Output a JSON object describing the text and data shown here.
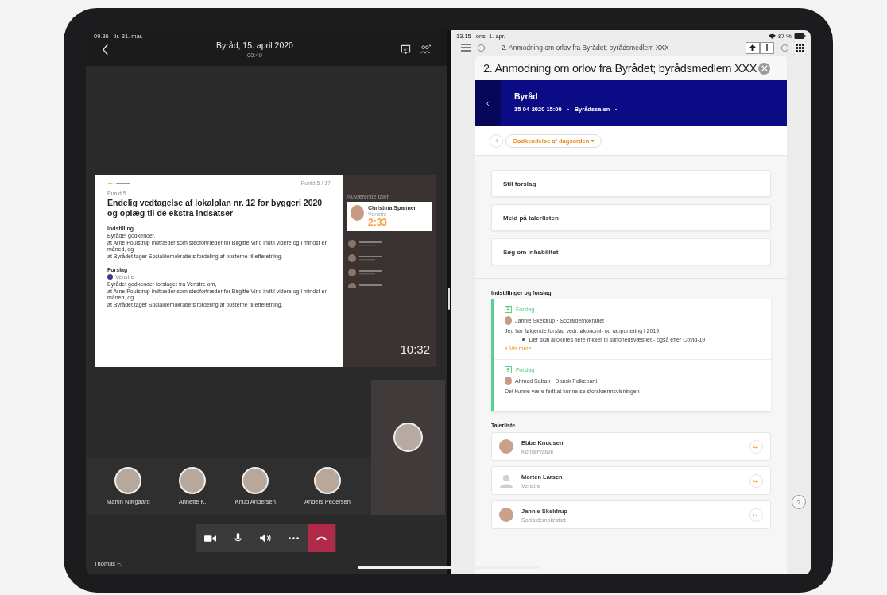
{
  "left_app": {
    "status_time": "09.36",
    "status_date": "tir. 31. mar.",
    "title": "Byråd, 15. april 2020",
    "duration": "00:40",
    "slide": {
      "page": "Punkt 5 / 17",
      "label": "Punkt 5",
      "heading": "Endelig vedtagelse af lokalplan nr. 12 for byggeri 2020 og oplæg til de ekstra indsatser",
      "sections": [
        {
          "heading": "Indstilling",
          "lines": [
            "Byrådet godkender,",
            "at Arne Poulstrup indtræder som stedfortræder for Birgitte Vind indtil videre og i mindst en måned, og",
            "at Byrådet tager Socialdemokratiets fordeling af posterne til efteretning."
          ]
        },
        {
          "heading": "Forslag",
          "party": "Venstre",
          "lines": [
            "Byrådet godkender forslaget fra Venstre om,",
            "at Arne Poulstrup indtræder som stedfortræder for Birgitte Vind indtil videre og i mindst en måned, og",
            "at Byrådet tager Socialdemokratiets fordeling af posterne til efteretning."
          ]
        }
      ]
    },
    "speaker_panel": {
      "label": "Nuværende taler",
      "name": "Christina Spanner",
      "party": "Venstre",
      "time": "2:33"
    },
    "clock": "10:32",
    "participants": [
      {
        "name": "Martin Nørgaard"
      },
      {
        "name": "Annette K."
      },
      {
        "name": "Knud Andersen"
      },
      {
        "name": "Anders Pedersen"
      }
    ],
    "controls": [
      {
        "kind": "camera"
      },
      {
        "kind": "mic"
      },
      {
        "kind": "speaker"
      },
      {
        "kind": "more"
      },
      {
        "kind": "hangup"
      }
    ],
    "self_name": "Thomas F."
  },
  "right_app": {
    "status_time": "13.15",
    "status_date": "ons. 1. apr.",
    "battery": "87 %",
    "toolbar_title": "2. Anmodning om orlov fra Byrådet; byrådsmedlem XXX",
    "help_label": "?",
    "modal": {
      "title": "2. Anmodning om orlov fra Byrådet; byrådsmedlem XXX",
      "meeting": {
        "name": "Byråd",
        "datetime": "15-04-2020 15:00",
        "location": "Byrådssalen"
      },
      "agenda_item": "Godkendelse af dagsorden",
      "actions": [
        "Stil forslag",
        "Meld på talerlisten",
        "Søg om inhabilitet"
      ],
      "proposals_heading": "Indstillinger og forslag",
      "proposals": [
        {
          "type": "Forslag",
          "author": "Jannie Skeldrup · Socialdemokratiet",
          "text": "Jeg har følgende forslag vedr. økonomi- og rapportering i 2019:",
          "bullets": [
            "Der skal allokeres flere midler til sundhedsvæsnet - også efter Covid-19"
          ],
          "more": "+ Vis mere"
        },
        {
          "type": "Forslag",
          "author": "Ahmad Sabah · Dansk Folkeparti",
          "text": "Det kunne være fedt at kunne se storskærmsvisningen"
        }
      ],
      "speakers_heading": "Talerliste",
      "speakers": [
        {
          "name": "Ebbe Knudsen",
          "party": "Konservative",
          "kind": "photo"
        },
        {
          "name": "Morten Larsen",
          "party": "Venstre",
          "kind": "placeholder"
        },
        {
          "name": "Jannie Skeldrup",
          "party": "Socialdemokratiet",
          "kind": "photo"
        }
      ]
    }
  }
}
